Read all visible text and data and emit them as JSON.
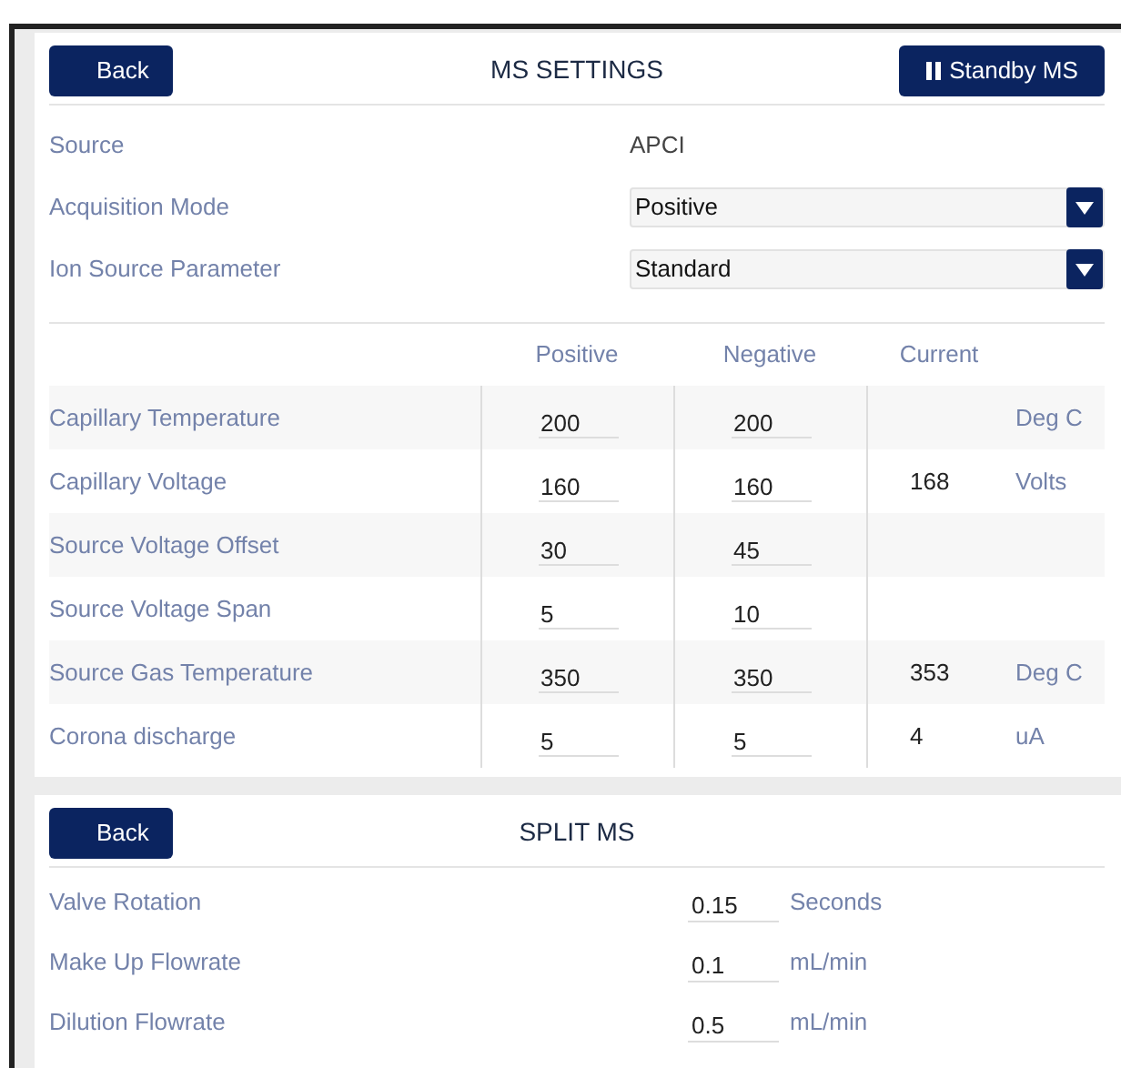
{
  "ms_settings": {
    "back_button": "Back",
    "title": "MS SETTINGS",
    "standby_button": "Standby MS",
    "source": {
      "label": "Source",
      "value": "APCI"
    },
    "dropdowns": [
      {
        "label": "Acquisition Mode",
        "value": "Positive"
      },
      {
        "label": "Ion Source Parameter",
        "value": "Standard"
      }
    ],
    "table": {
      "columns": [
        "Positive",
        "Negative",
        "Current"
      ],
      "rows": [
        {
          "label": "Capillary Temperature",
          "positive": "200",
          "negative": "200",
          "unit": "Deg C"
        },
        {
          "label": "Capillary Voltage",
          "positive": "160",
          "negative": "160",
          "current": "168",
          "unit": "Volts"
        },
        {
          "label": "Source Voltage Offset",
          "positive": "30",
          "negative": "45"
        },
        {
          "label": "Source Voltage Span",
          "positive": "5",
          "negative": "10"
        },
        {
          "label": "Source Gas Temperature",
          "positive": "350",
          "negative": "350",
          "current": "353",
          "unit": "Deg C"
        },
        {
          "label": "Corona discharge",
          "positive": "5",
          "negative": "5",
          "current": "4",
          "unit": "uA"
        }
      ]
    }
  },
  "split_ms": {
    "back_button": "Back",
    "title": "SPLIT MS",
    "rows": [
      {
        "label": "Valve Rotation",
        "value": "0.15",
        "unit": "Seconds"
      },
      {
        "label": "Make Up Flowrate",
        "value": "0.1",
        "unit": "mL/min"
      },
      {
        "label": "Dilution Flowrate",
        "value": "0.5",
        "unit": "mL/min"
      }
    ]
  }
}
